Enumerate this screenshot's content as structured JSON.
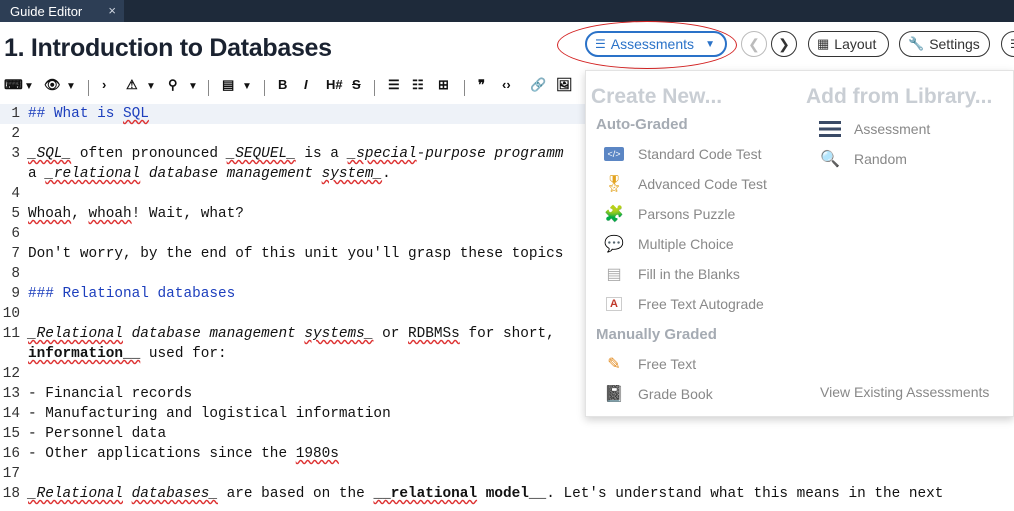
{
  "tab": {
    "label": "Guide Editor",
    "close": "×"
  },
  "page_title": "1. Introduction to Databases",
  "header_buttons": {
    "assessments": "Assessments",
    "layout": "Layout",
    "settings": "Settings"
  },
  "toolbar": {
    "heading_btn": "H#"
  },
  "editor_lines": [
    {
      "n": "1",
      "text": "## What is SQL"
    },
    {
      "n": "2",
      "text": ""
    },
    {
      "n": "3",
      "text": " SQL  often pronounced  SEQUEL  is a  special-purpose programm"
    },
    {
      "n": "",
      "text": "a  relational database management system ."
    },
    {
      "n": "4",
      "text": ""
    },
    {
      "n": "5",
      "text": "Whoah, whoah! Wait, what?"
    },
    {
      "n": "6",
      "text": ""
    },
    {
      "n": "7",
      "text": "Don't worry, by the end of this unit you'll grasp these topics"
    },
    {
      "n": "8",
      "text": ""
    },
    {
      "n": "9",
      "text": "### Relational databases"
    },
    {
      "n": "10",
      "text": ""
    },
    {
      "n": "11",
      "text": " Relational database management systems  or RDBMSs for short, "
    },
    {
      "n": "",
      "text": "information   used for:"
    },
    {
      "n": "12",
      "text": ""
    },
    {
      "n": "13",
      "text": "- Financial records"
    },
    {
      "n": "14",
      "text": "- Manufacturing and logistical information"
    },
    {
      "n": "15",
      "text": "- Personnel data"
    },
    {
      "n": "16",
      "text": "- Other applications since the 1980s"
    },
    {
      "n": "17",
      "text": ""
    },
    {
      "n": "18",
      "text": " Relational databases  are based on the   relational model  . Let's understand what this means in the next"
    }
  ],
  "panel": {
    "create_new": "Create New...",
    "add_from_library": "Add from Library...",
    "auto_graded": "Auto-Graded",
    "manually_graded": "Manually Graded",
    "auto_items": [
      "Standard Code Test",
      "Advanced Code Test",
      "Parsons Puzzle",
      "Multiple Choice",
      "Fill in the Blanks",
      "Free Text Autograde"
    ],
    "manual_items": [
      "Free Text",
      "Grade Book"
    ],
    "library_items": [
      "Assessment",
      "Random"
    ],
    "view_existing": "View Existing Assessments"
  }
}
